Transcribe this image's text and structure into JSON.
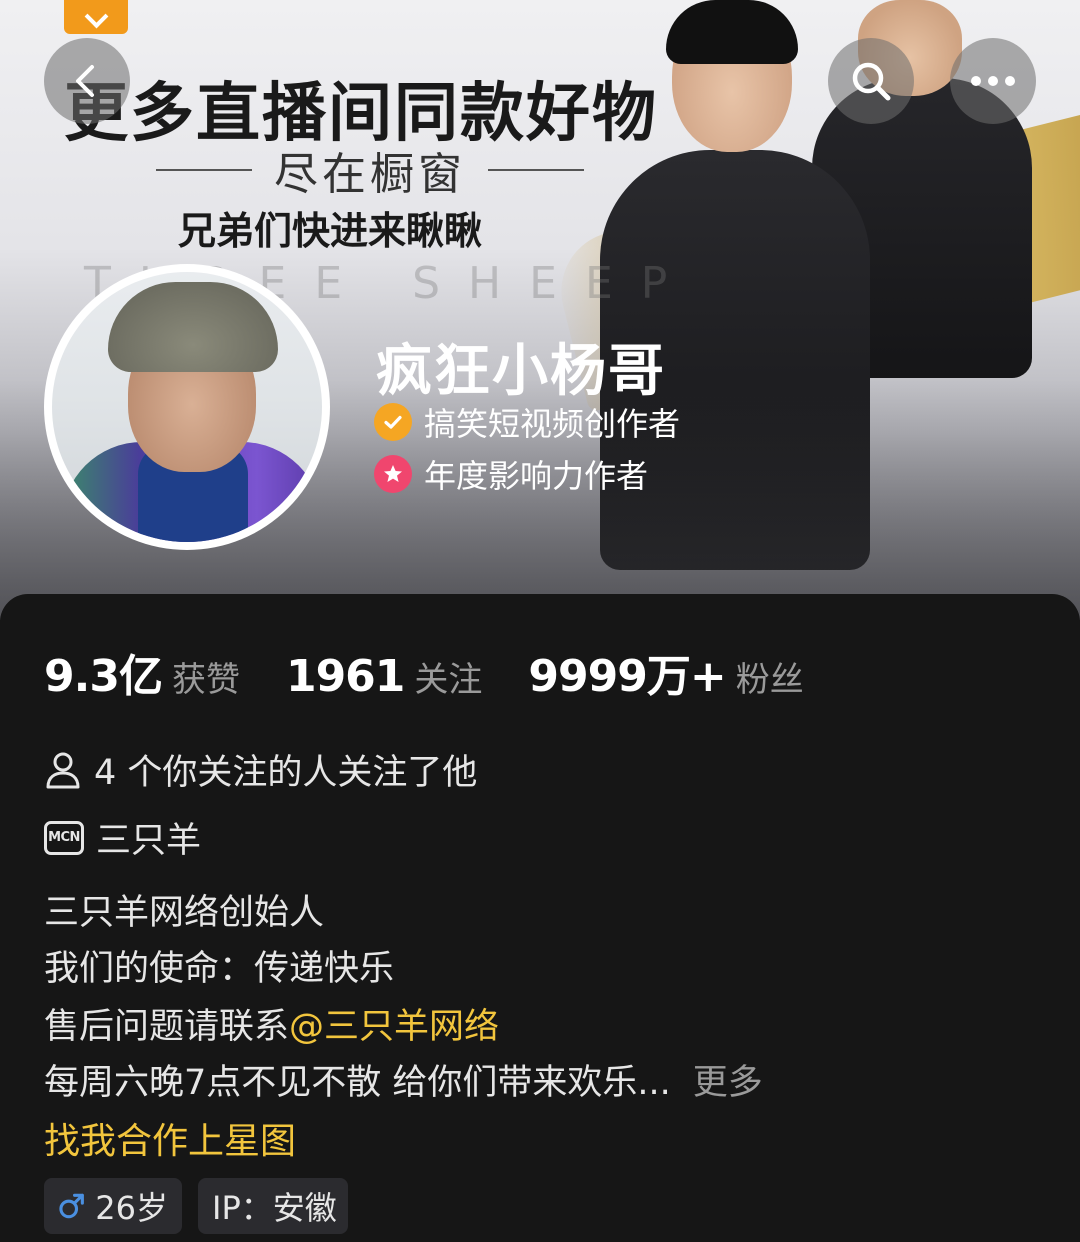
{
  "banner": {
    "title": "更多直播间同款好物",
    "subtitle": "尽在橱窗",
    "subtitle2": "兄弟们快进来瞅瞅",
    "watermark": "THREE SHEEP"
  },
  "profile": {
    "name": "疯狂小杨哥",
    "badges": [
      {
        "label": "搞笑短视频创作者",
        "icon": "verified-check-icon",
        "color": "#f5a623"
      },
      {
        "label": "年度影响力作者",
        "icon": "star-badge-icon",
        "color": "#f0466e"
      }
    ]
  },
  "stats": [
    {
      "value": "9.3亿",
      "label": "获赞"
    },
    {
      "value": "1961",
      "label": "关注"
    },
    {
      "value": "9999万+",
      "label": "粉丝"
    }
  ],
  "mutual_follow": "4 个你关注的人关注了他",
  "mcn": {
    "icon_text": "MCN",
    "name": "三只羊"
  },
  "bio": {
    "line1": "三只羊网络创始人",
    "line2": "我们的使命：传递快乐",
    "line3_prefix": "售后问题请联系",
    "line3_mention": "@三只羊网络",
    "line4": "每周六晚7点不见不散 给你们带来欢乐...",
    "more": "更多"
  },
  "star_map_link": "找我合作上星图",
  "tags": {
    "age": "26岁",
    "ip": "IP：安徽"
  },
  "colors": {
    "accent_gold": "#f2c53d",
    "panel_bg": "#161616",
    "tag_bg": "#2b2b2f",
    "male_blue": "#4a8fe0"
  }
}
